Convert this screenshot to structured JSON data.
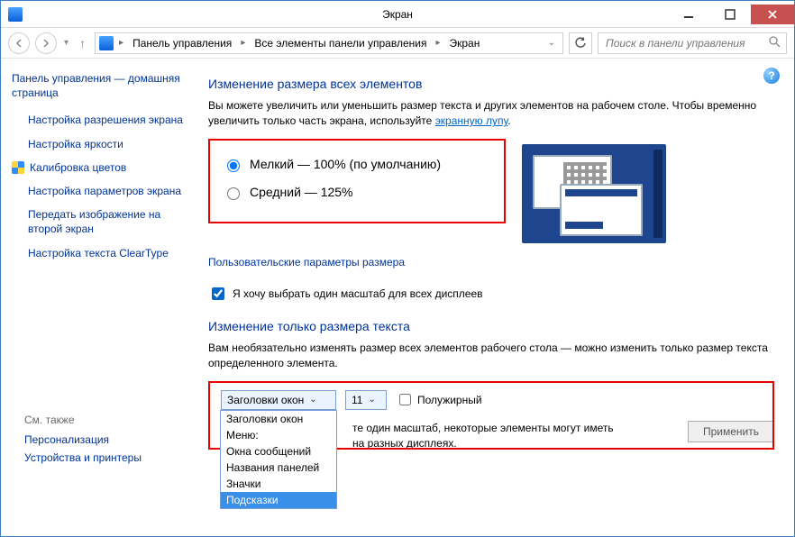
{
  "window": {
    "title": "Экран"
  },
  "breadcrumb": {
    "seg1": "Панель управления",
    "seg2": "Все элементы панели управления",
    "seg3": "Экран"
  },
  "search": {
    "placeholder": "Поиск в панели управления"
  },
  "sidebar": {
    "home": "Панель управления — домашняя страница",
    "links": [
      "Настройка разрешения экрана",
      "Настройка яркости",
      "Калибровка цветов",
      "Настройка параметров экрана",
      "Передать изображение на второй экран",
      "Настройка текста ClearType"
    ]
  },
  "seealso": {
    "hdr": "См. также",
    "personalization": "Персонализация",
    "devices": "Устройства и принтеры"
  },
  "main": {
    "h1": "Изменение размера всех элементов",
    "desc_prefix": "Вы можете увеличить или уменьшить размер текста и других элементов на рабочем столе. Чтобы временно увеличить только часть экрана, используйте ",
    "desc_link": "экранную лупу",
    "desc_suffix": ".",
    "radio_small": "Мелкий — 100% (по умолчанию)",
    "radio_medium": "Средний — 125%",
    "custom_link": "Пользовательские параметры размера",
    "one_scale": "Я хочу выбрать один масштаб для всех дисплеев",
    "h2": "Изменение только размера текста",
    "desc2": "Вам необязательно изменять размер всех элементов рабочего стола — можно изменить только размер текста определенного элемента.",
    "element_select": "Заголовки окон",
    "size_select": "11",
    "bold": "Полужирный",
    "dropdown": [
      "Заголовки окон",
      "Меню:",
      "Окна сообщений",
      "Названия панелей",
      "Значки",
      "Подсказки"
    ],
    "note_line1": "те один масштаб, некоторые элементы могут иметь",
    "note_line2": "на разных дисплеях.",
    "apply": "Применить"
  }
}
